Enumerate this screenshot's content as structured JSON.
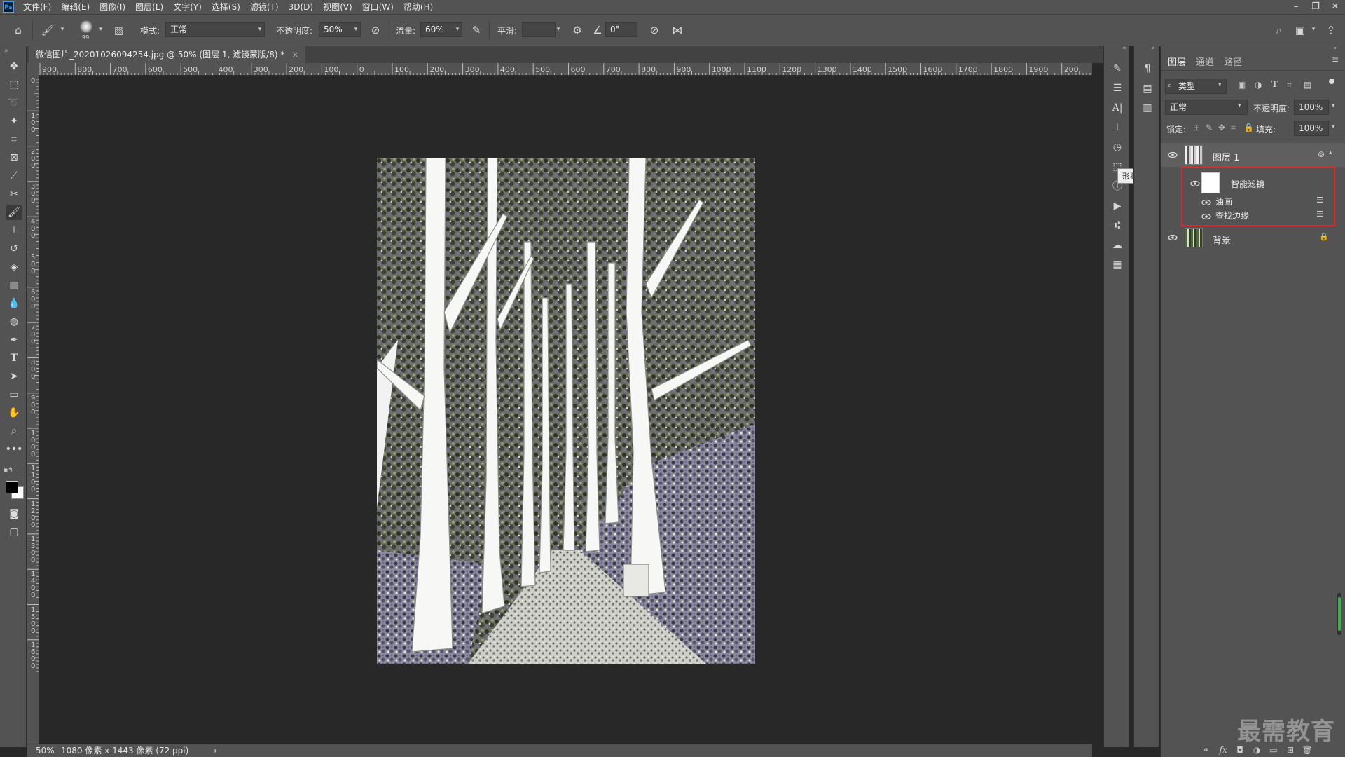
{
  "app": {
    "logo": "Ps"
  },
  "menu": [
    "文件(F)",
    "编辑(E)",
    "图像(I)",
    "图层(L)",
    "文字(Y)",
    "选择(S)",
    "滤镜(T)",
    "3D(D)",
    "视图(V)",
    "窗口(W)",
    "帮助(H)"
  ],
  "window_controls": [
    "minimize-icon",
    "restore-icon",
    "close-icon"
  ],
  "options": {
    "brush_size": "99",
    "mode_label": "模式:",
    "mode_value": "正常",
    "opacity_label": "不透明度:",
    "opacity_value": "50%",
    "flow_label": "流量:",
    "flow_value": "60%",
    "smoothing_label": "平滑:",
    "smoothing_value": "",
    "angle_value": "0°"
  },
  "document": {
    "tab_title": "微信图片_20201026094254.jpg @ 50% (图层 1, 滤镜蒙版/8) *",
    "close": "×"
  },
  "ruler": {
    "h_labels": [
      "900",
      "800",
      "700",
      "600",
      "500",
      "400",
      "300",
      "200",
      "100",
      "0",
      "100",
      "200",
      "300",
      "400",
      "500",
      "600",
      "700",
      "800",
      "900",
      "1000",
      "1100",
      "1200",
      "1300",
      "1400",
      "1500",
      "1600",
      "1700",
      "1800",
      "1900",
      "200"
    ],
    "v_labels": [
      "0",
      "100",
      "200",
      "300",
      "400",
      "500",
      "600",
      "700",
      "800",
      "900",
      "1000",
      "1100",
      "1200",
      "1300",
      "1400",
      "1500",
      "1600"
    ]
  },
  "status": {
    "zoom": "50%",
    "info": "1080 像素 x 1443 像素 (72 ppi)",
    "arrow": "›"
  },
  "tooltip": "形状",
  "layers_panel": {
    "tabs": [
      "图层",
      "通道",
      "路径"
    ],
    "filter_kind": "类型",
    "blend_mode": "正常",
    "opacity_label": "不透明度:",
    "opacity_value": "100%",
    "lock_label": "锁定:",
    "fill_label": "填充:",
    "fill_value": "100%",
    "layers": [
      {
        "name": "图层 1",
        "visible": true
      },
      {
        "name": "背景",
        "visible": true,
        "locked": true
      }
    ],
    "smart_filters": {
      "label": "智能滤镜",
      "items": [
        "油画",
        "查找边缘"
      ]
    }
  },
  "watermark": "最需教育",
  "colors": {
    "accent_highlight": "#e02a2a",
    "ui_bg": "#535353",
    "canvas_bg": "#282828"
  }
}
